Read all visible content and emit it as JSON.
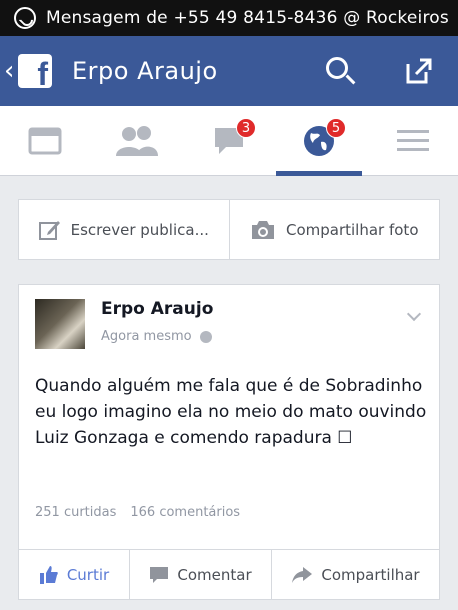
{
  "status_bar": {
    "notification": "Mensagem de +55 49 8415-8436 @ Rockeiros",
    "icon": "whatsapp-icon"
  },
  "header": {
    "back": "‹",
    "logo": "f",
    "title": "Erpo Araujo"
  },
  "tabs": {
    "messages_badge": "3",
    "notifications_badge": "5",
    "active": "notifications"
  },
  "composer": {
    "write": "Escrever publica...",
    "photo": "Compartilhar foto"
  },
  "post": {
    "author": "Erpo Araujo",
    "time": "Agora mesmo",
    "text": "Quando alguém me fala que é de Sobradinho eu logo imagino ela no meio do mato ouvindo Luiz Gonzaga e comendo rapadura ☐",
    "likes": "251 curtidas",
    "comments": "166 comentários"
  },
  "actions": {
    "like": "Curtir",
    "comment": "Comentar",
    "share": "Compartilhar"
  },
  "colors": {
    "brand": "#3b5998",
    "badge": "#e02a2a",
    "like": "#5b7bd5"
  }
}
